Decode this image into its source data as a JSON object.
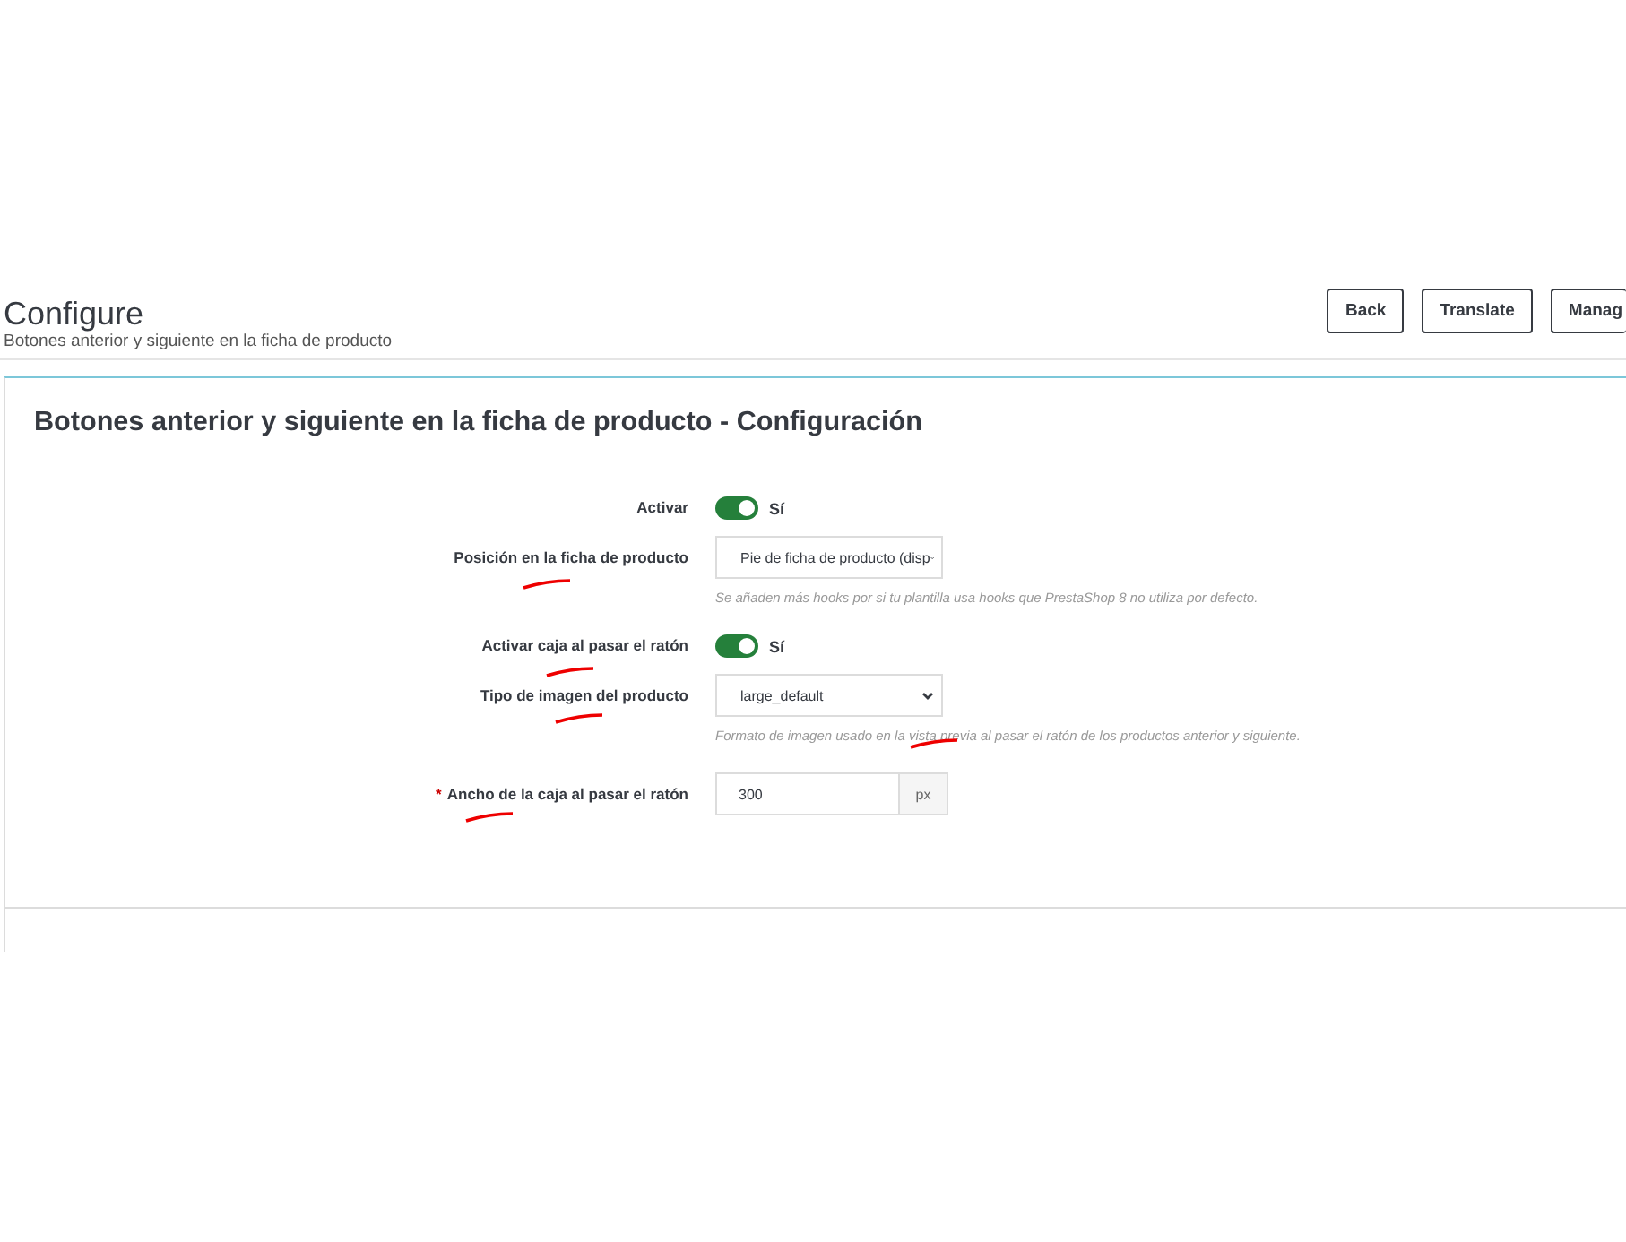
{
  "header": {
    "title": "Configure",
    "subtitle": "Botones anterior y siguiente en la ficha de producto",
    "buttons": [
      "Back",
      "Translate",
      "Manag"
    ]
  },
  "panel": {
    "title": "Botones anterior y siguiente en la ficha de producto - Configuración",
    "fields": [
      {
        "kind": "switch",
        "label": "Activar",
        "on": true,
        "value": "Sí",
        "label_underlined": false
      },
      {
        "kind": "select",
        "label": "Posición en la ficha de producto",
        "value": "Pie de ficha de producto (disp",
        "help": "Se añaden más hooks por si tu plantilla usa hooks que PrestaShop 8 no utiliza por defecto.",
        "label_underlined": true,
        "help_underlined": false
      },
      {
        "kind": "switch",
        "label": "Activar caja al pasar el ratón",
        "on": true,
        "value": "Sí",
        "label_underlined": true
      },
      {
        "kind": "select",
        "label": "Tipo de imagen del producto",
        "value": "large_default",
        "help": "Formato de imagen usado en la vista previa al pasar el ratón de los productos anterior y siguiente.",
        "label_underlined": true,
        "help_underlined": true
      },
      {
        "kind": "addon",
        "label": "Ancho de la caja al pasar el ratón",
        "required_mark": "*",
        "value": "300",
        "suffix": "px",
        "label_underlined": true
      }
    ]
  }
}
